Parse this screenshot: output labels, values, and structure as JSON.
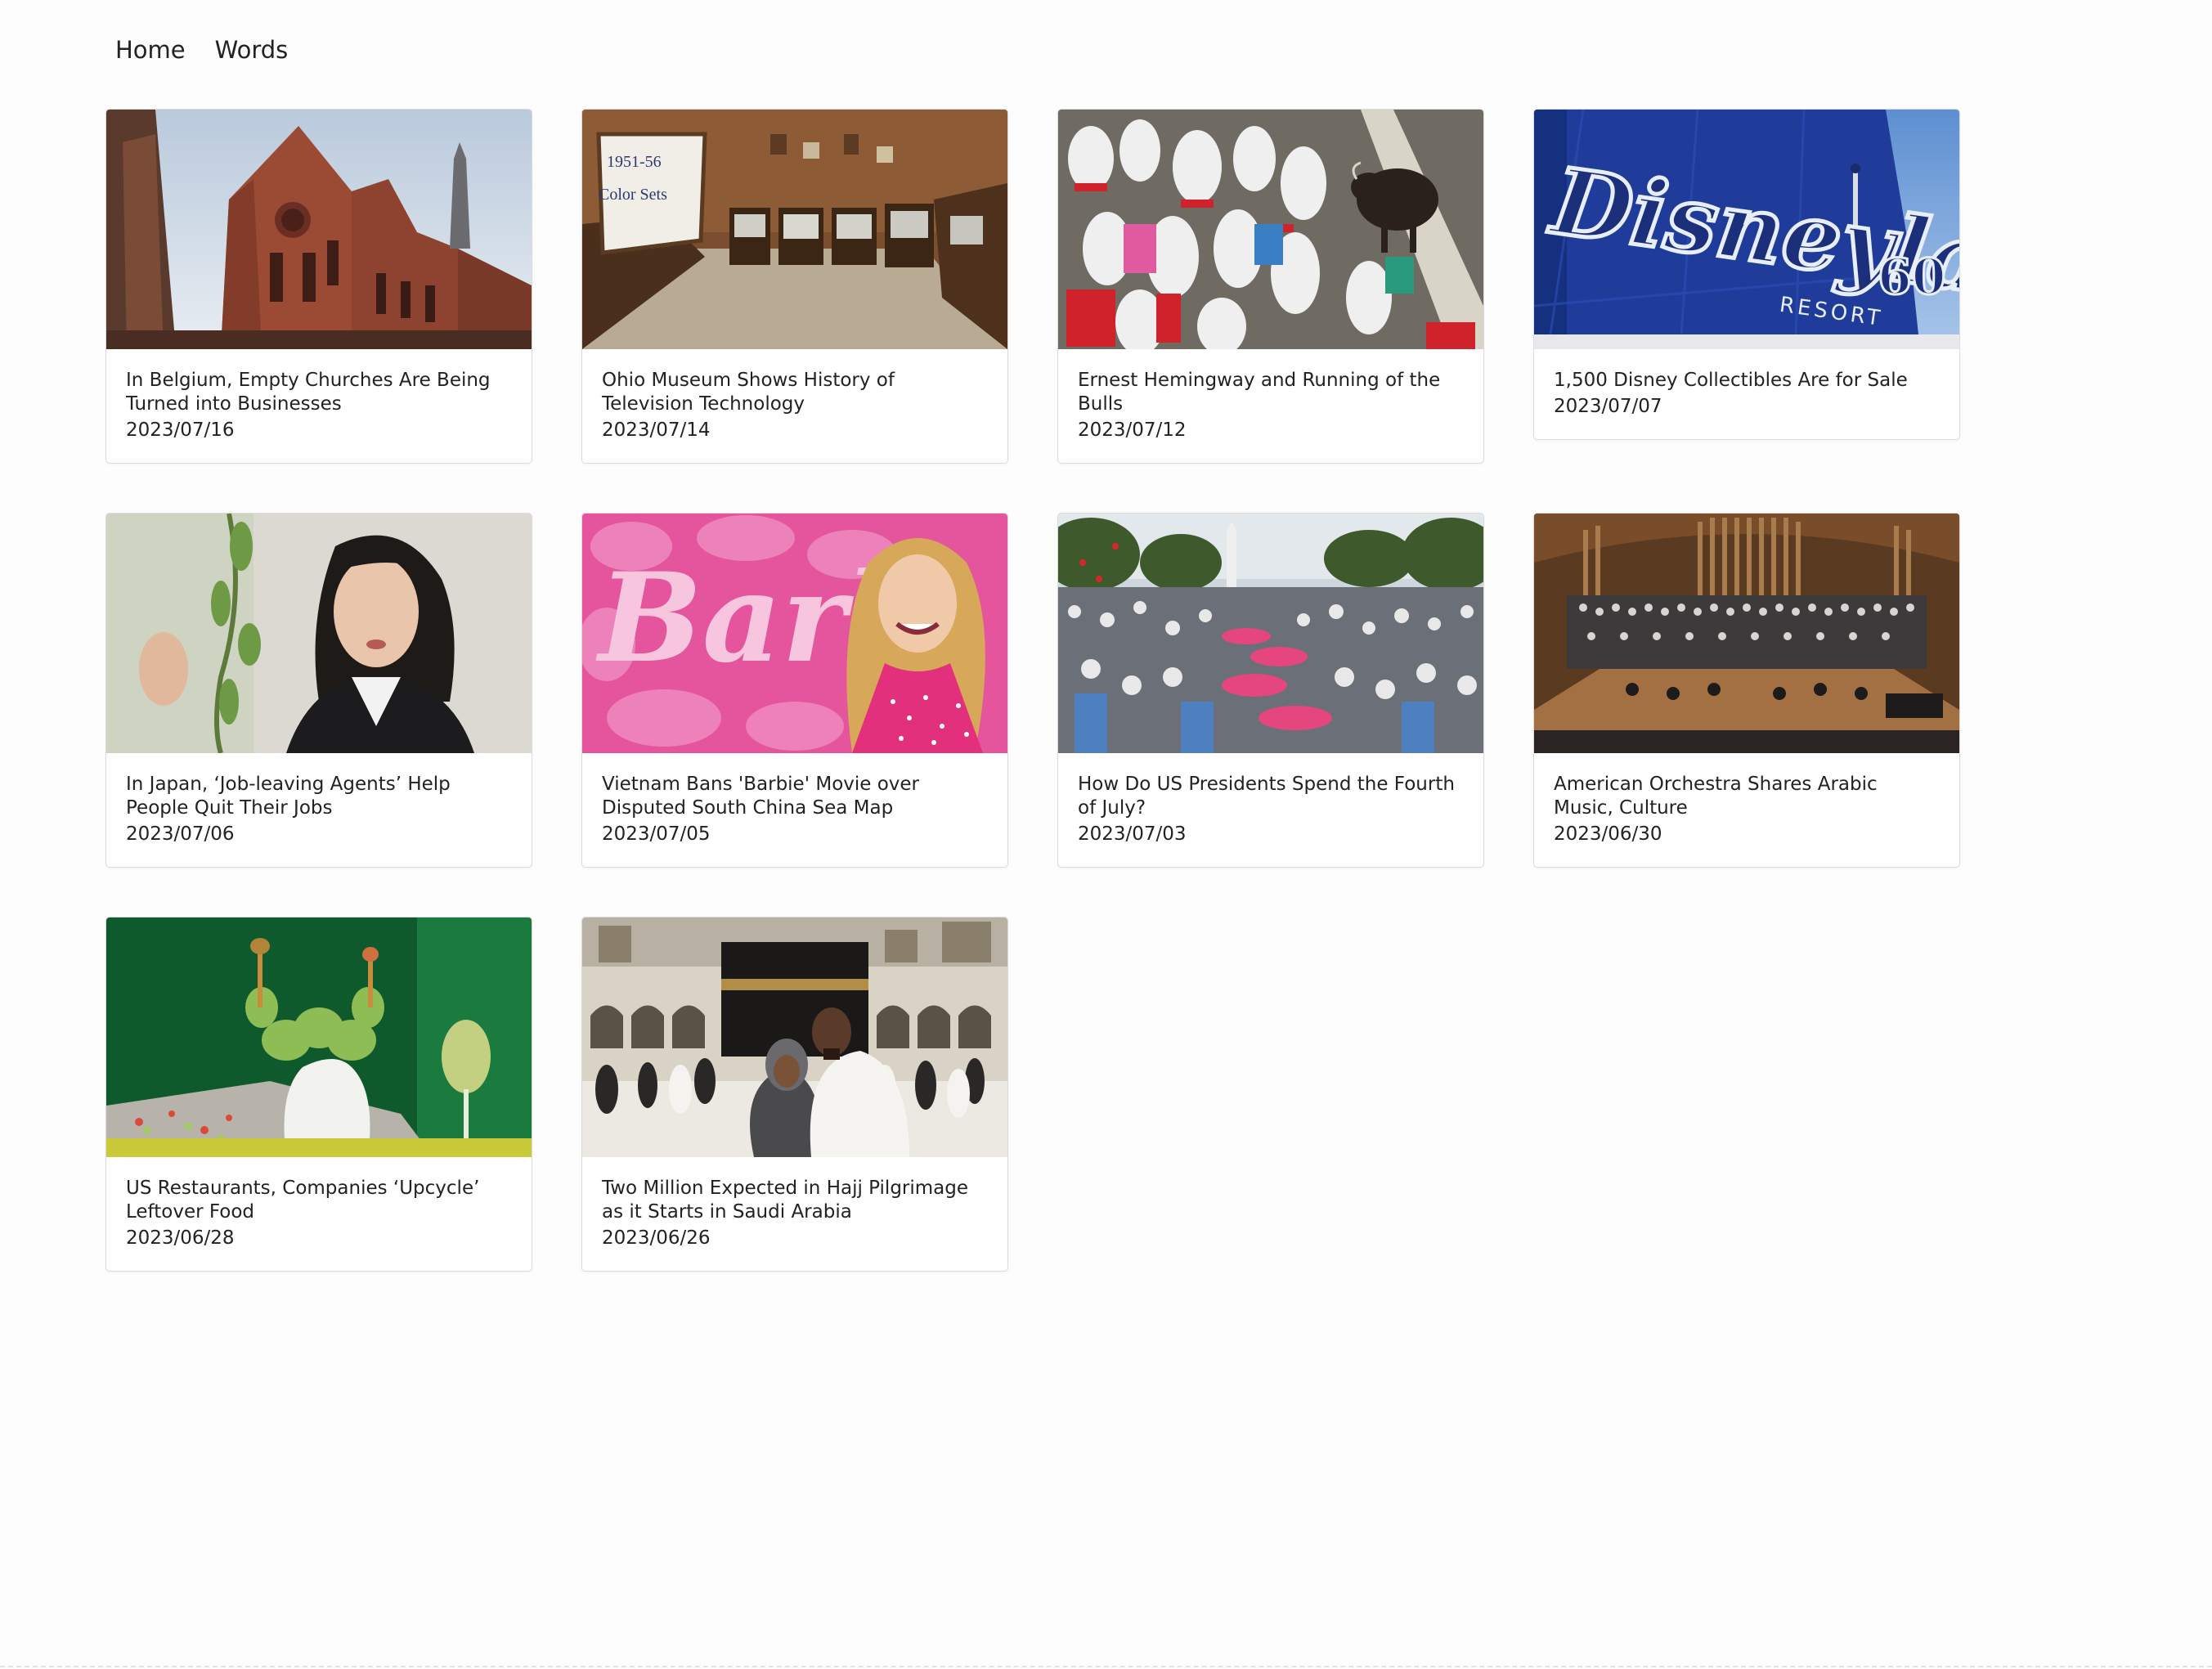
{
  "nav": {
    "home": "Home",
    "words": "Words"
  },
  "articles": [
    {
      "title": "In Belgium, Empty Churches Are Being Turned into Businesses",
      "date": "2023/07/16",
      "image": "brick-church-photo"
    },
    {
      "title": "Ohio Museum Shows History of Television Technology",
      "date": "2023/07/14",
      "image": "tv-museum-photo",
      "image_text": [
        "1951-56",
        "Color Sets"
      ]
    },
    {
      "title": "Ernest Hemingway and Running of the Bulls",
      "date": "2023/07/12",
      "image": "bull-run-photo"
    },
    {
      "title": "1,500 Disney Collectibles Are for Sale",
      "date": "2023/07/07",
      "image": "disneyland-sign-photo",
      "image_text": [
        "Disneyland",
        "60",
        "RESORT"
      ]
    },
    {
      "title": "In Japan, ‘Job-leaving Agents’ Help People Quit Their Jobs",
      "date": "2023/07/06",
      "image": "woman-speaking-photo"
    },
    {
      "title": "Vietnam Bans 'Barbie' Movie over Disputed South China Sea Map",
      "date": "2023/07/05",
      "image": "barbie-premiere-photo",
      "image_text": [
        "Barbie"
      ]
    },
    {
      "title": "How Do US Presidents Spend the Fourth of July?",
      "date": "2023/07/03",
      "image": "white-house-crowd-photo"
    },
    {
      "title": "American Orchestra Shares Arabic Music, Culture",
      "date": "2023/06/30",
      "image": "orchestra-hall-photo"
    },
    {
      "title": "US Restaurants, Companies ‘Upcycle’ Leftover Food",
      "date": "2023/06/28",
      "image": "food-platter-photo"
    },
    {
      "title": "Two Million Expected in Hajj Pilgrimage as it Starts in Saudi Arabia",
      "date": "2023/06/26",
      "image": "kaaba-pilgrims-photo"
    }
  ],
  "colors": {
    "background": "#fdfdfd",
    "card_border": "#dcdcdc",
    "text": "#222222"
  }
}
